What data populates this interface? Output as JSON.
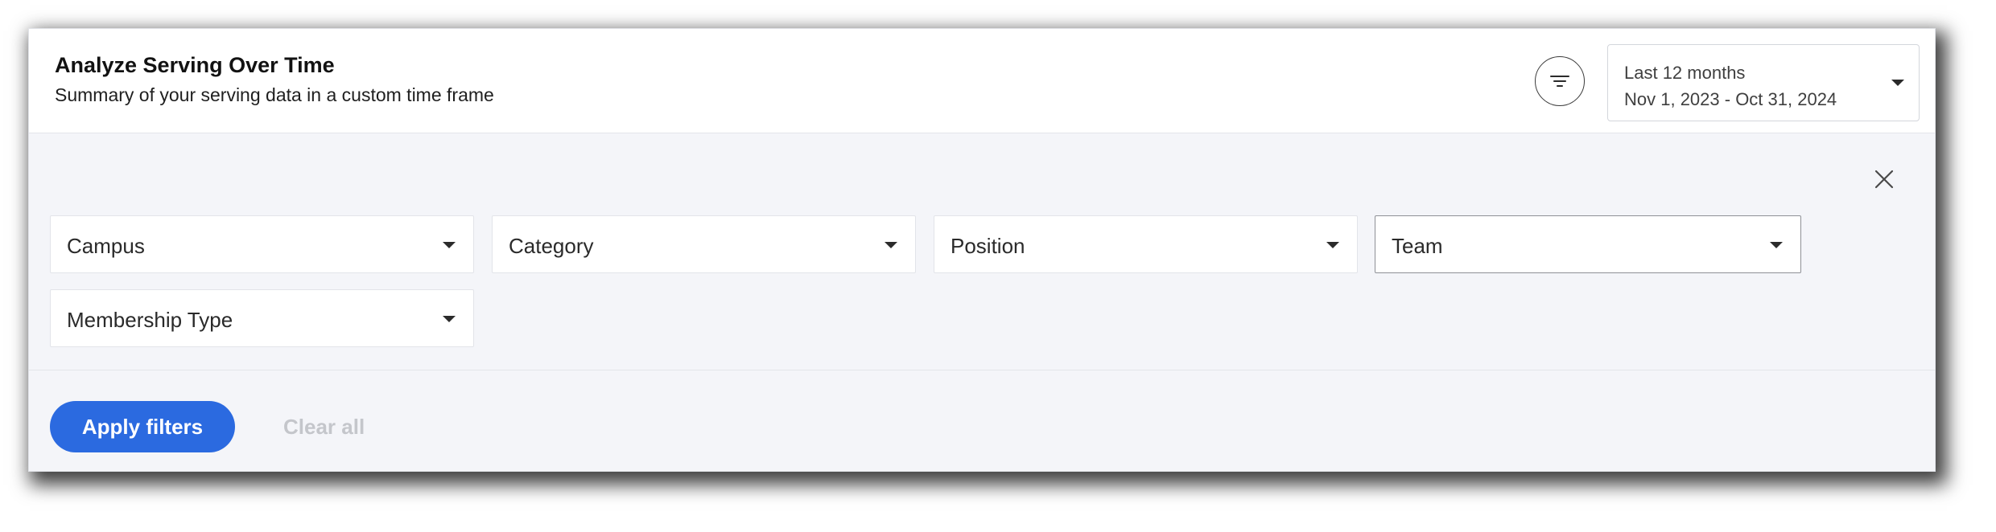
{
  "header": {
    "title": "Analyze Serving Over Time",
    "subtitle": "Summary of your serving data in a custom time frame"
  },
  "date_range": {
    "preset": "Last 12 months",
    "range": "Nov 1, 2023 - Oct 31, 2024"
  },
  "filters": {
    "campus": "Campus",
    "category": "Category",
    "position": "Position",
    "team": "Team",
    "membership_type": "Membership Type"
  },
  "actions": {
    "apply": "Apply filters",
    "clear": "Clear all"
  },
  "colors": {
    "accent": "#2b6ae0",
    "panel_bg": "#f4f5f9",
    "disabled_text": "#c4c6cb"
  },
  "icons": {
    "filter": "filter-icon",
    "close": "close-icon",
    "dropdown": "caret-down-icon"
  }
}
